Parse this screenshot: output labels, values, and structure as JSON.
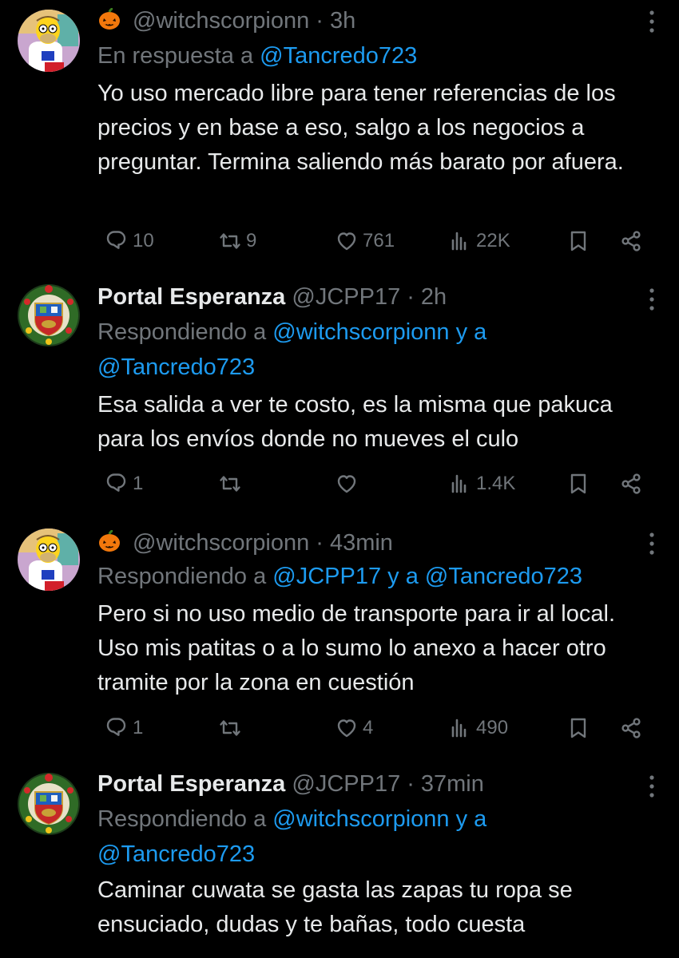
{
  "tweets": [
    {
      "display_name": "",
      "handle": "@witchscorpionn",
      "time": "3h",
      "reply_prefix": "En respuesta a",
      "reply_to_line1": "@Tancredo723",
      "reply_to_line2": "",
      "body": "Yo uso mercado libre para tener referencias de los precios y en base a eso, salgo a los negocios a preguntar. Termina saliendo más barato por afuera.",
      "replies": "10",
      "retweets": "9",
      "likes": "761",
      "views": "22K",
      "avatar": "homer-avatar"
    },
    {
      "display_name": "Portal Esperanza",
      "handle": "@JCPP17",
      "time": "2h",
      "reply_prefix": "Respondiendo a",
      "reply_to_line1": "@witchscorpionn y a",
      "reply_to_line2": "@Tancredo723",
      "body": "Esa salida a ver te costo, es la misma que pakuca para los envíos donde no mueves el culo",
      "replies": "1",
      "retweets": "",
      "likes": "",
      "views": "1.4K",
      "avatar": "wreath-avatar"
    },
    {
      "display_name": "",
      "handle": "@witchscorpionn",
      "time": "43min",
      "reply_prefix": "Respondiendo a",
      "reply_to_line1": "@JCPP17 y a @Tancredo723",
      "reply_to_line2": "",
      "body": "Pero si no uso medio de transporte para ir al local. Uso mis patitas o a lo sumo lo anexo a hacer otro tramite por la zona en cuestión",
      "replies": "1",
      "retweets": "",
      "likes": "4",
      "views": "490",
      "avatar": "homer-avatar"
    },
    {
      "display_name": "Portal Esperanza",
      "handle": "@JCPP17",
      "time": "37min",
      "reply_prefix": "Respondiendo a",
      "reply_to_line1": "@witchscorpionn y a",
      "reply_to_line2": "@Tancredo723",
      "body": "Caminar cuwata se gasta las zapas tu ropa se ensuciado, dudas y te bañas, todo cuesta",
      "replies": "",
      "retweets": "",
      "likes": "",
      "views": "",
      "avatar": "wreath-avatar"
    }
  ],
  "separator": "·",
  "colors": {
    "background": "#000000",
    "text": "#e7e9ea",
    "muted": "#71767b",
    "link": "#1d9bf0"
  }
}
